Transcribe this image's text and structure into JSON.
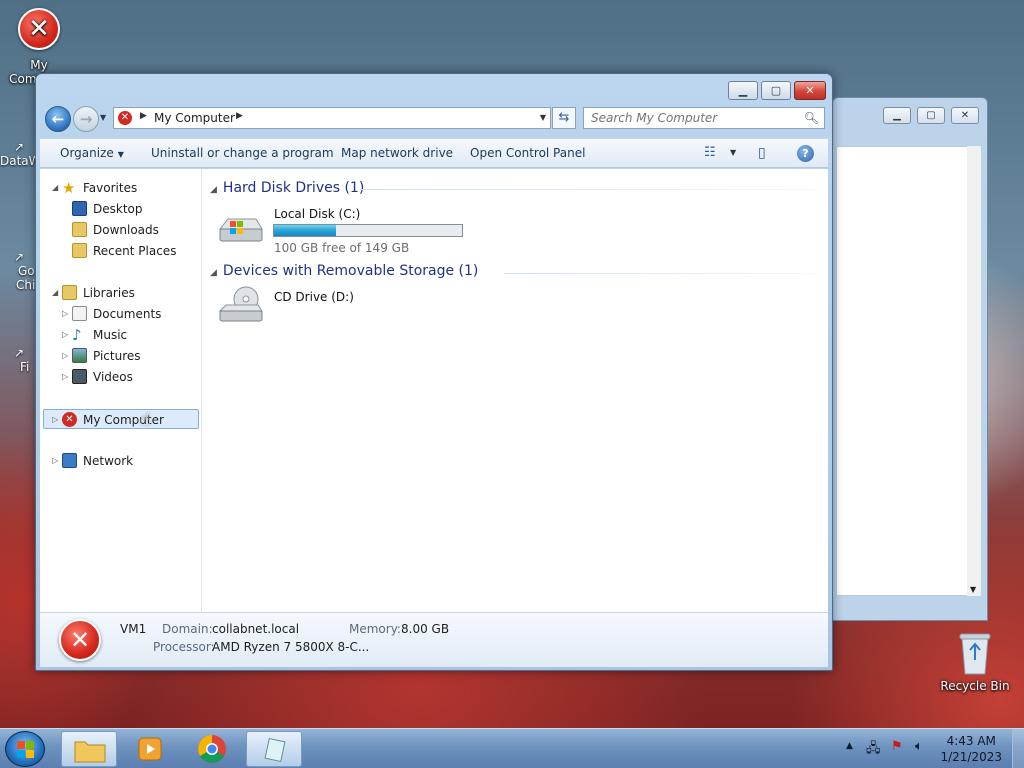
{
  "desktop": {
    "my_computer_label": "My Computer",
    "side_labels": [
      "DataW",
      "Go",
      "Chi",
      "Fi"
    ],
    "recycle_bin_label": "Recycle Bin"
  },
  "window": {
    "address_crumb": "My Computer",
    "search_placeholder": "Search My Computer",
    "toolbar": {
      "organize": "Organize",
      "uninstall": "Uninstall or change a program",
      "map_drive": "Map network drive",
      "control_panel": "Open Control Panel"
    },
    "nav": {
      "favorites": "Favorites",
      "desktop": "Desktop",
      "downloads": "Downloads",
      "recent": "Recent Places",
      "libraries": "Libraries",
      "documents": "Documents",
      "music": "Music",
      "pictures": "Pictures",
      "videos": "Videos",
      "my_computer": "My Computer",
      "network": "Network"
    },
    "groups": {
      "hdd": "Hard Disk Drives (1)",
      "removable": "Devices with Removable Storage (1)"
    },
    "drives": {
      "c_name": "Local Disk (C:)",
      "c_free": "100 GB free of 149 GB",
      "c_used_fraction": 0.33,
      "d_name": "CD Drive (D:)"
    },
    "details": {
      "name": "VM1",
      "domain_label": "Domain:",
      "domain_value": "collabnet.local",
      "memory_label": "Memory:",
      "memory_value": "8.00 GB",
      "processor_label": "Processor:",
      "processor_value": "AMD Ryzen 7 5800X 8-C..."
    }
  },
  "taskbar": {
    "time": "4:43 AM",
    "date": "1/21/2023"
  },
  "colors": {
    "accent": "#1e3287",
    "close": "#d2463a",
    "taskbar": "#6f93bf"
  }
}
